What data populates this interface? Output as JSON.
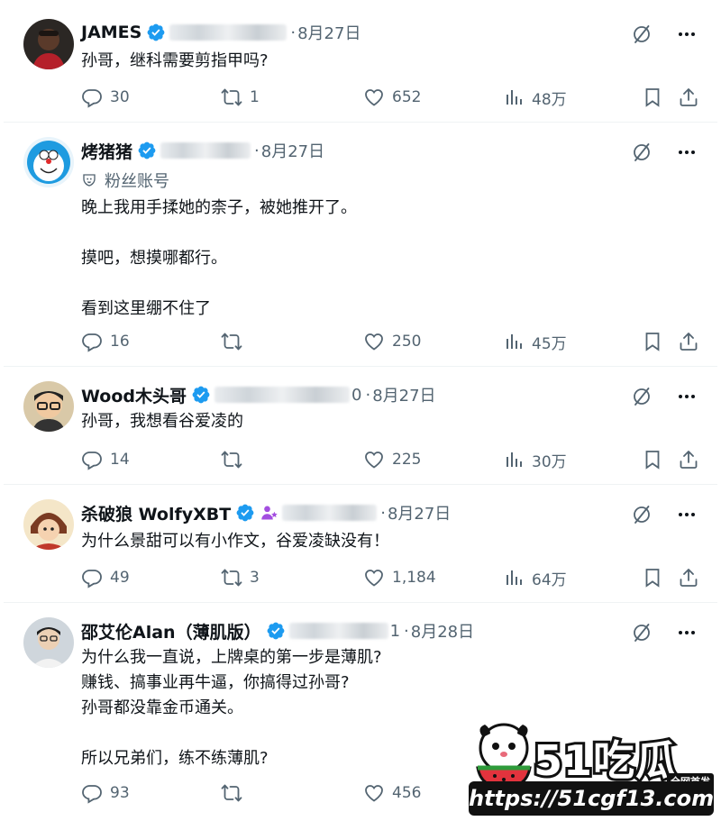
{
  "icons": {
    "reply": "reply-icon",
    "retweet": "retweet-icon",
    "like": "heart-icon",
    "views": "views-icon",
    "bookmark": "bookmark-icon",
    "share": "share-icon",
    "grok": "grok-icon",
    "more": "more-icon"
  },
  "colors": {
    "verified": "#1d9bf0",
    "text": "#0f1419",
    "secondary": "#536471"
  },
  "tweets": [
    {
      "name": "JAMES",
      "handle_tail": "",
      "dot": "·",
      "date": "8月27日",
      "body": "孙哥，继科需要剪指甲吗?",
      "stats": {
        "replies": "30",
        "retweets": "1",
        "likes": "652",
        "views": "48万"
      }
    },
    {
      "name": "烤猪猪",
      "handle_tail": "",
      "dot": "·",
      "date": "8月27日",
      "fan_label": "粉丝账号",
      "body": "晚上我用手揉她的柰子，被她推开了。\n\n摸吧，想摸哪都行。\n\n看到这里绷不住了",
      "stats": {
        "replies": "16",
        "retweets": "",
        "likes": "250",
        "views": "45万"
      }
    },
    {
      "name": "Wood木头哥",
      "handle_tail": "0",
      "dot": "·",
      "date": "8月27日",
      "body": "孙哥，我想看谷爱凌的",
      "stats": {
        "replies": "14",
        "retweets": "",
        "likes": "225",
        "views": "30万"
      }
    },
    {
      "name": "杀破狼 WolfyXBT",
      "handle_tail": "",
      "dot": "·",
      "date": "8月27日",
      "body": "为什么景甜可以有小作文，谷爱凌缺没有！",
      "stats": {
        "replies": "49",
        "retweets": "3",
        "likes": "1,184",
        "views": "64万"
      }
    },
    {
      "name": "邵艾伦Alan（薄肌版）",
      "handle_tail": "1",
      "dot": "·",
      "date": "8月28日",
      "body": "为什么我一直说，上牌桌的第一步是薄肌?\n赚钱、搞事业再牛逼，你搞得过孙哥?\n孙哥都没靠金币通关。\n\n所以兄弟们，练不练薄肌?",
      "stats": {
        "replies": "93",
        "retweets": "",
        "likes": "456",
        "views": ""
      }
    }
  ],
  "watermark": {
    "brand": "51吃瓜",
    "tag": "全网首发",
    "url": "https://51cgf13.com"
  }
}
